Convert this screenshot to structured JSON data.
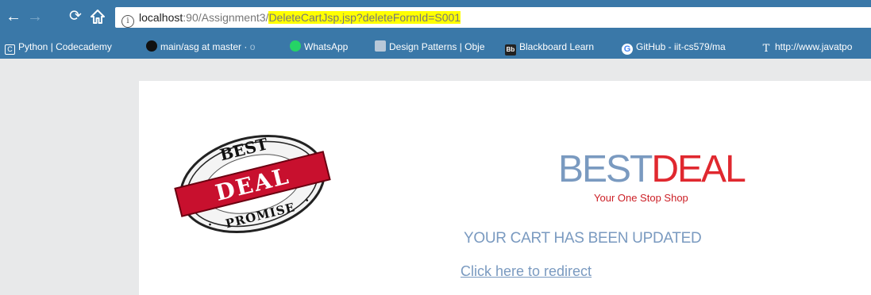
{
  "browser": {
    "url": {
      "host": "localhost",
      "port_path": ":90/Assignment3/",
      "highlighted": "DeleteCartJsp.jsp?deleteFormId=S001"
    }
  },
  "bookmarks": [
    {
      "icon": "codecademy-icon",
      "label": "Python | Codecademy",
      "color": "#ffffff"
    },
    {
      "icon": "github-icon",
      "label": "main/asg at master · ",
      "fade": "o",
      "color": "#000000"
    },
    {
      "icon": "whatsapp-icon",
      "label": "WhatsApp",
      "color": "#25d366"
    },
    {
      "icon": "design-patterns-icon",
      "label": "Design Patterns | Obje",
      "color": "#b8c8d8"
    },
    {
      "icon": "blackboard-icon",
      "label": "Blackboard Learn",
      "color": "#222222"
    },
    {
      "icon": "google-icon",
      "label": "GitHub - iit-cs579/ma",
      "color": "#ffffff"
    },
    {
      "icon": "javatpoint-icon",
      "label": "http://www.javatpo",
      "color": "#ffffff"
    }
  ],
  "page": {
    "logo": {
      "top_text": "BEST",
      "banner_text": "DEAL",
      "bottom_text": "PROMISE"
    },
    "brand": {
      "best": "BEST",
      "deal": "DEAL",
      "tagline": "Your One Stop Shop"
    },
    "status_message": "YOUR CART HAS BEEN UPDATED",
    "redirect_link": "Click here to redirect"
  },
  "colors": {
    "chrome": "#3a78a8",
    "brand_blue": "#7a9ac0",
    "brand_red": "#e0282f",
    "url_highlight": "#ffff00"
  }
}
